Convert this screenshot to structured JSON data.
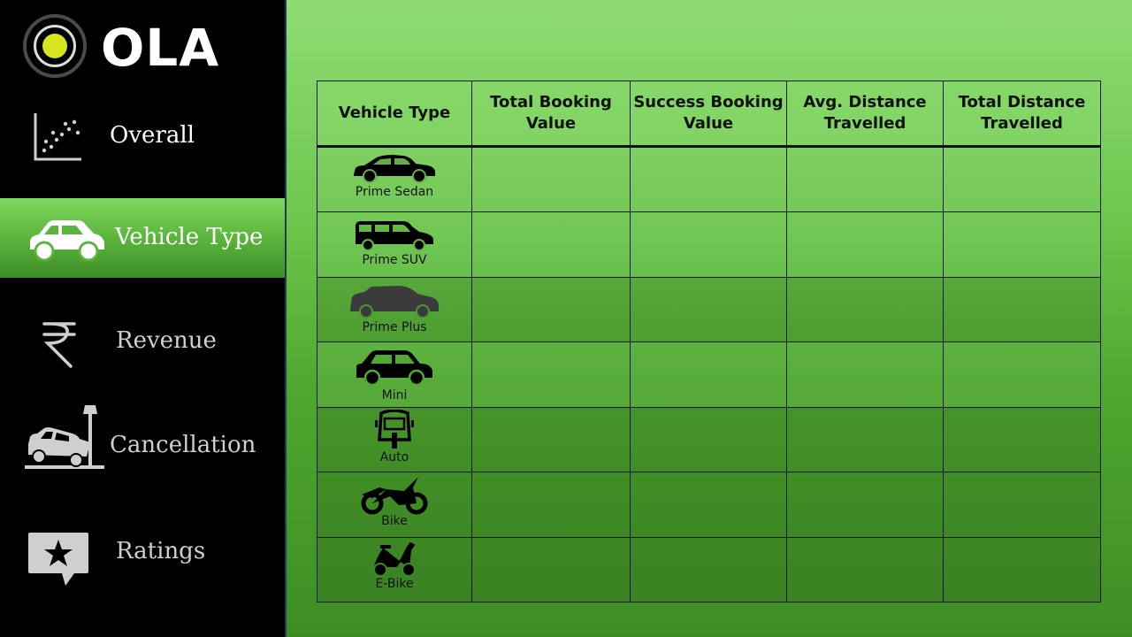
{
  "brand": {
    "name": "OLA",
    "dot_color": "#d6e61f"
  },
  "nav": {
    "items": [
      {
        "label": "Overall",
        "icon": "scatter-chart-icon",
        "active": false
      },
      {
        "label": "Vehicle Type",
        "icon": "car-icon",
        "active": true
      },
      {
        "label": "Revenue",
        "icon": "rupee-icon",
        "active": false
      },
      {
        "label": "Cancellation",
        "icon": "car-crash-icon",
        "active": false
      },
      {
        "label": "Ratings",
        "icon": "star-review-icon",
        "active": false
      }
    ]
  },
  "table": {
    "headers": [
      "Vehicle Type",
      "Total Booking Value",
      "Success Booking Value",
      "Avg. Distance Travelled",
      "Total Distance Travelled"
    ],
    "rows": [
      {
        "vehicle": "Prime Sedan",
        "icon": "sedan-icon"
      },
      {
        "vehicle": "Prime SUV",
        "icon": "suv-icon"
      },
      {
        "vehicle": "Prime Plus",
        "icon": "prime-plus-car-icon"
      },
      {
        "vehicle": "Mini",
        "icon": "mini-car-icon"
      },
      {
        "vehicle": "Auto",
        "icon": "auto-rickshaw-icon"
      },
      {
        "vehicle": "Bike",
        "icon": "motorbike-icon"
      },
      {
        "vehicle": "E-Bike",
        "icon": "scooter-icon"
      }
    ]
  },
  "colors": {
    "sidebar": "#000000",
    "accent_green": "#5bb53c",
    "background_top": "#8fdc74",
    "background_bottom": "#3e8d24"
  }
}
